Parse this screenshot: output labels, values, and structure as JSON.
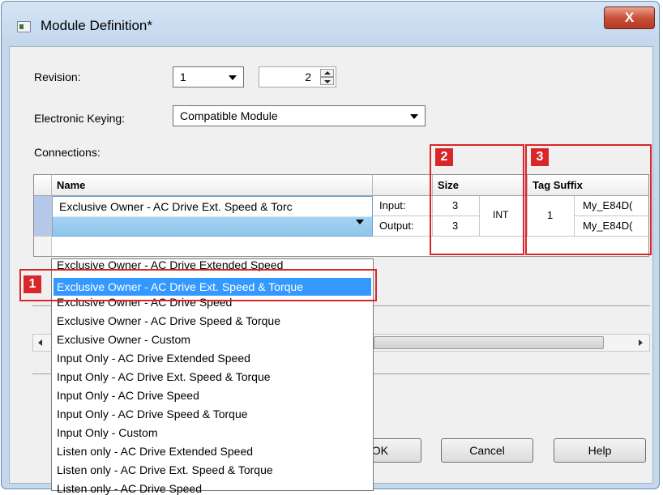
{
  "window": {
    "title": "Module Definition*",
    "close_glyph": "X"
  },
  "revision": {
    "label": "Revision:",
    "major": "1",
    "minor": "2"
  },
  "keying": {
    "label": "Electronic Keying:",
    "value": "Compatible Module"
  },
  "connections": {
    "label": "Connections:",
    "columns": {
      "name": "Name",
      "size": "Size",
      "tag_suffix": "Tag Suffix"
    },
    "row": {
      "name": "Exclusive Owner - AC Drive Ext. Speed & Torc",
      "input_label": "Input:",
      "output_label": "Output:",
      "input_size": "3",
      "output_size": "3",
      "data_type": "INT",
      "tag_index": "1",
      "input_tag": "My_E84D(",
      "output_tag": "My_E84D("
    }
  },
  "dropdown_options": [
    "Exclusive Owner - AC Drive Extended Speed",
    "Exclusive Owner - AC Drive Ext. Speed & Torque",
    "Exclusive Owner - AC Drive Speed",
    "Exclusive Owner - AC Drive Speed & Torque",
    "Exclusive Owner - Custom",
    "Input Only - AC Drive Extended Speed",
    "Input Only - AC Drive Ext. Speed & Torque",
    "Input Only - AC Drive Speed",
    "Input Only - AC Drive Speed & Torque",
    "Input Only - Custom",
    "Listen only - AC Drive Extended Speed",
    "Listen only - AC Drive Ext. Speed & Torque",
    "Listen only - AC Drive Speed"
  ],
  "selected_option_index": 1,
  "buttons": {
    "ok": "OK",
    "cancel": "Cancel",
    "help": "Help"
  },
  "callouts": [
    "1",
    "2",
    "3"
  ],
  "colors": {
    "callout_red": "#d9262a",
    "selection_blue": "#3399ff"
  }
}
